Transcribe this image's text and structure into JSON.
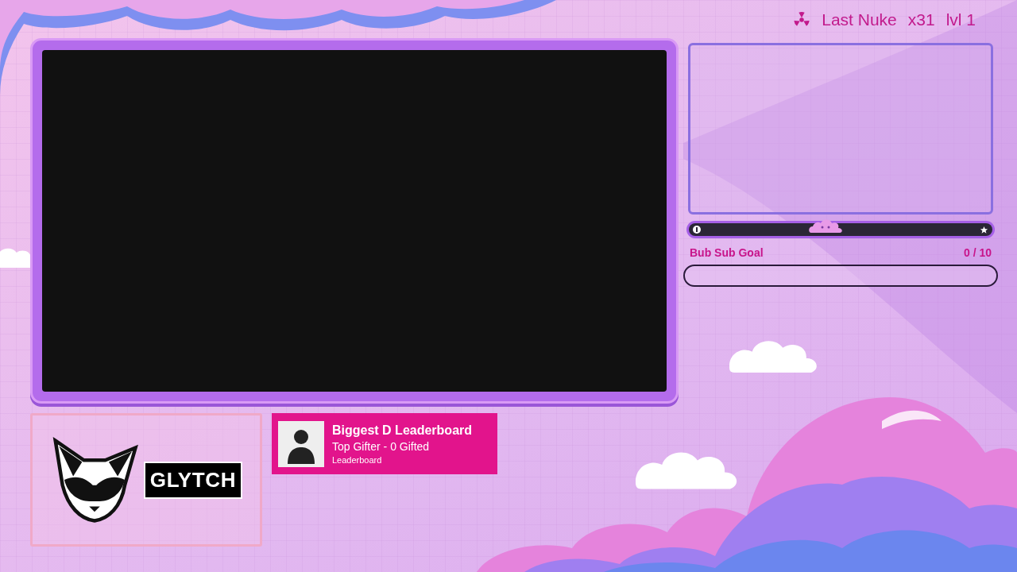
{
  "nuke": {
    "label": "Last Nuke",
    "count": "x31",
    "level_text": "lvl 1"
  },
  "hype_bar": {
    "level": 0.45
  },
  "sub_goal": {
    "title": "Bub Sub Goal",
    "count": "0 / 10",
    "level": 0
  },
  "logo": {
    "text": "GLYTCH"
  },
  "leaderboard": {
    "title": "Biggest D Leaderboard",
    "subtitle": "Top Gifter - 0 Gifted",
    "caption": "Leaderboard"
  }
}
